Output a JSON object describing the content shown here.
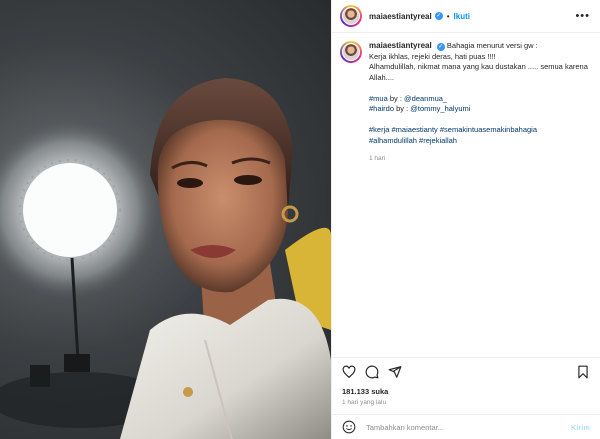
{
  "post": {
    "username": "maiaestiantyreal",
    "follow_label": "Ikuti",
    "separator": "•",
    "more_label": "•••"
  },
  "caption": {
    "username": "maiaestiantyreal",
    "line1": "Bahagia menurut versi gw :",
    "line2": "Kerja ikhlas, rejeki deras, hati puas !!!!",
    "line3": "Alhamdulillah, nikmat mana yang kau dustakan ..... semua karena Allah....",
    "mua_tag": "#mua",
    "by_label": " by : ",
    "mua_mention": "@deanmua_",
    "hairdo_tag": "#hairdo",
    "hairdo_mention": "@tommy_halyumi",
    "hashtags_line1": "#kerja #maiaestianty #semakintuasemakinbahagia",
    "hashtags_line2": "#alhamdulillah #rejekiallah",
    "time": "1 hari"
  },
  "stats": {
    "likes": "181.133 suka",
    "posted_ago": "1 hari yang lalu"
  },
  "comment_box": {
    "placeholder": "Tambahkan komentar...",
    "send_label": "Kirim"
  },
  "icons": {
    "like": "heart-icon",
    "comment": "comment-icon",
    "share": "share-icon",
    "save": "bookmark-icon",
    "emoji": "emoji-icon",
    "verified": "verified-badge-icon"
  },
  "colors": {
    "link": "#00376b",
    "follow": "#0095f6",
    "muted": "#8e8e8e",
    "send_disabled": "#b2dffc"
  }
}
